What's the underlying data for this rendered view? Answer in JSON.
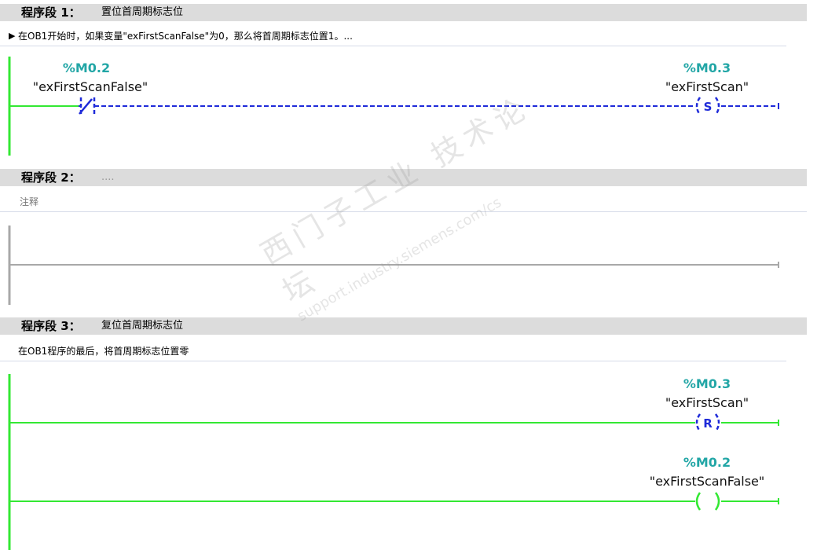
{
  "networks": [
    {
      "title": "程序段 1：",
      "description": "置位首周期标志位",
      "comment": "在OB1开始时，如果变量\"exFirstScanFalse\"为0，那么将首周期标志位置1。...",
      "contact": {
        "address": "%M0.2",
        "tag": "\"exFirstScanFalse\"",
        "symbol": "/"
      },
      "coil": {
        "address": "%M0.3",
        "tag": "\"exFirstScan\"",
        "symbol": "S"
      }
    },
    {
      "title": "程序段 2：",
      "description": "....",
      "comment": "注释"
    },
    {
      "title": "程序段 3：",
      "description": "复位首周期标志位",
      "comment": "在OB1程序的最后，将首周期标志位置零",
      "coil_reset": {
        "address": "%M0.3",
        "tag": "\"exFirstScan\"",
        "symbol": "R"
      },
      "coil_assign": {
        "address": "%M0.2",
        "tag": "\"exFirstScanFalse\"",
        "symbol": ""
      }
    }
  ],
  "watermark": {
    "line1": "西门子工业 技术论坛",
    "line2": "support.industry.siemens.com/cs"
  },
  "colors": {
    "energized": "#33e833",
    "not_energized": "#1f2bd9",
    "inactive_rail": "#a8a8a8",
    "address": "#22a6a6"
  }
}
